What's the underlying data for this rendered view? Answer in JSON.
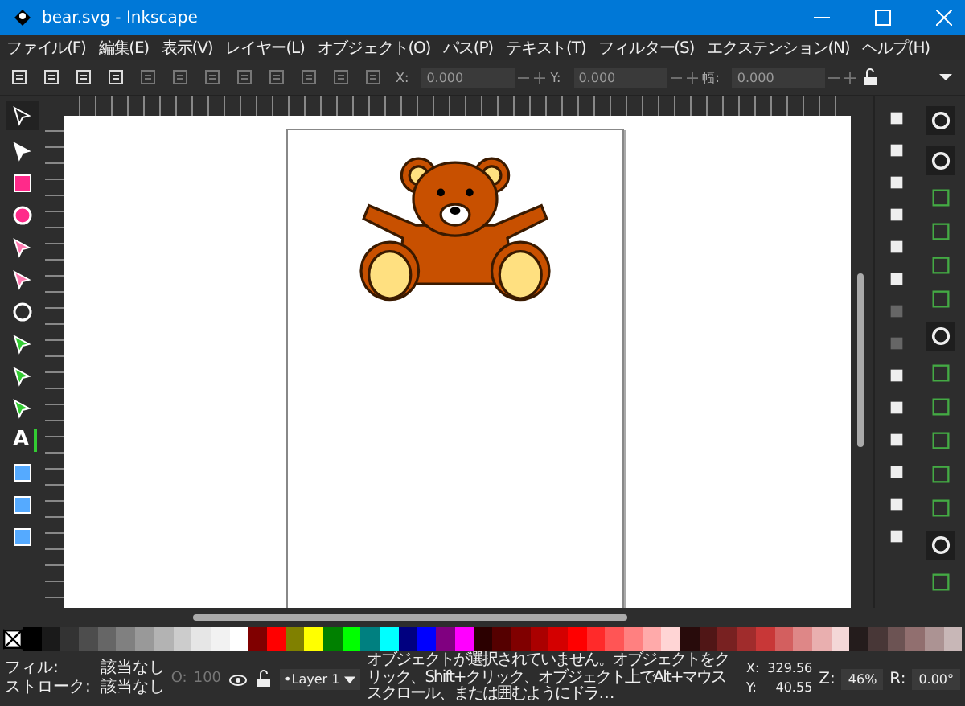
{
  "window": {
    "title": "bear.svg - Inkscape"
  },
  "menu": [
    "ファイル(F)",
    "編集(E)",
    "表示(V)",
    "レイヤー(L)",
    "オブジェクト(O)",
    "パス(P)",
    "テキスト(T)",
    "フィルター(S)",
    "エクステンション(N)",
    "ヘルプ(H)"
  ],
  "toolbar": {
    "fields": [
      {
        "label": "X:",
        "value": "0.000"
      },
      {
        "label": "Y:",
        "value": "0.000"
      },
      {
        "label": "幅:",
        "value": "0.000"
      }
    ]
  },
  "toolbox": {
    "text_tool_glyph": "A"
  },
  "palette": [
    {
      "color": "#000000"
    },
    {
      "color": "#1a1a1a"
    },
    {
      "color": "#333333"
    },
    {
      "color": "#4d4d4d"
    },
    {
      "color": "#666666"
    },
    {
      "color": "#808080"
    },
    {
      "color": "#999999"
    },
    {
      "color": "#b3b3b3"
    },
    {
      "color": "#cccccc"
    },
    {
      "color": "#e6e6e6"
    },
    {
      "color": "#f2f2f2"
    },
    {
      "color": "#ffffff"
    },
    {
      "color": "#800000"
    },
    {
      "color": "#ff0000"
    },
    {
      "color": "#808000"
    },
    {
      "color": "#ffff00"
    },
    {
      "color": "#008000"
    },
    {
      "color": "#00ff00"
    },
    {
      "color": "#008080"
    },
    {
      "color": "#00ffff"
    },
    {
      "color": "#000080"
    },
    {
      "color": "#0000ff"
    },
    {
      "color": "#800080"
    },
    {
      "color": "#ff00ff"
    },
    {
      "color": "#2b0000"
    },
    {
      "color": "#550000"
    },
    {
      "color": "#800000"
    },
    {
      "color": "#aa0000"
    },
    {
      "color": "#d40000"
    },
    {
      "color": "#ff0000"
    },
    {
      "color": "#ff2a2a"
    },
    {
      "color": "#ff5555"
    },
    {
      "color": "#ff8080"
    },
    {
      "color": "#ffaaaa"
    },
    {
      "color": "#ffd5d5"
    },
    {
      "color": "#280b0b"
    },
    {
      "color": "#501616"
    },
    {
      "color": "#782121"
    },
    {
      "color": "#a02c2c"
    },
    {
      "color": "#c83737"
    },
    {
      "color": "#d35f5f"
    },
    {
      "color": "#de8787"
    },
    {
      "color": "#e9afaf"
    },
    {
      "color": "#f4d7d7"
    },
    {
      "color": "#241c1c"
    },
    {
      "color": "#483737"
    },
    {
      "color": "#6c5353"
    },
    {
      "color": "#916f6f"
    },
    {
      "color": "#ac9393"
    },
    {
      "color": "#c8b7b7"
    }
  ],
  "status": {
    "fill_label": "フィル:",
    "fill_value": "該当なし",
    "stroke_label": "ストローク:",
    "stroke_value": "該当なし",
    "opacity_label": "O:",
    "opacity_value": "100",
    "layer": "•Layer 1",
    "message": "オブジェクトが選択されていません。オブジェクトをクリック、Shift+クリック、オブジェクト上でAlt+マウススクロール、または囲むようにドラ…",
    "x_label": "X:",
    "x_value": "329.56",
    "y_label": "Y:",
    "y_value": "40.55",
    "zoom_label": "Z:",
    "zoom_value": "46%",
    "rotate_label": "R:",
    "rotate_value": "0.00°"
  }
}
